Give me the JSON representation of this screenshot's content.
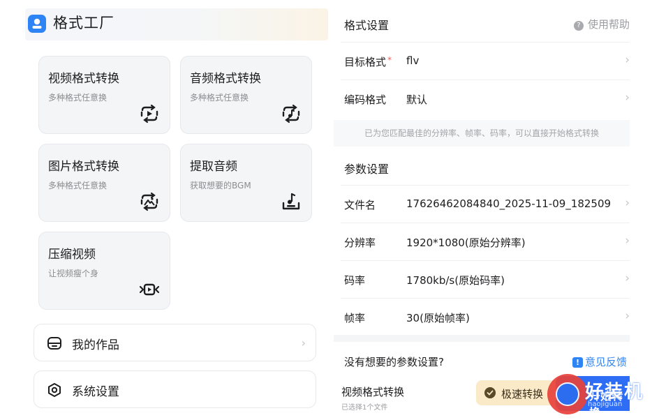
{
  "app": {
    "title": "格式工厂",
    "logo_icon": "user-icon",
    "accent": "#2e84f5"
  },
  "tools": [
    {
      "title": "视频格式转换",
      "subtitle": "多种格式任意换",
      "icon": "video-convert-icon"
    },
    {
      "title": "音频格式转换",
      "subtitle": "多种格式任意换",
      "icon": "audio-convert-icon"
    },
    {
      "title": "图片格式转换",
      "subtitle": "多种格式任意换",
      "icon": "image-convert-icon"
    },
    {
      "title": "提取音频",
      "subtitle": "获取想要的BGM",
      "icon": "extract-audio-icon"
    },
    {
      "title": "压缩视频",
      "subtitle": "让视频瘦个身",
      "icon": "compress-video-icon"
    }
  ],
  "menu": {
    "works": {
      "label": "我的作品",
      "icon": "album-icon",
      "chevron": "›"
    },
    "settings": {
      "label": "系统设置",
      "icon": "settings-icon"
    }
  },
  "format_settings": {
    "title": "格式设置",
    "help": "使用帮助",
    "help_icon": "?",
    "target_label": "目标格式",
    "required_mark": "*",
    "target_value": "flv",
    "codec_label": "编码格式",
    "codec_value": "默认",
    "hint": "已为您匹配最佳的分辨率、帧率、码率，可以直接开始格式转换"
  },
  "param_settings": {
    "title": "参数设置",
    "rows": [
      {
        "label": "文件名",
        "value": "17626462084840_2025-11-09_182509"
      },
      {
        "label": "分辨率",
        "value": "1920*1080(原始分辨率)"
      },
      {
        "label": "码率",
        "value": "1780kb/s(原始码率)"
      },
      {
        "label": "帧率",
        "value": "30(原始帧率)"
      }
    ],
    "chevron": "›"
  },
  "feedback": {
    "question": "没有想要的参数设置?",
    "link": "意见反馈",
    "icon": "!"
  },
  "bottom": {
    "title": "视频格式转换",
    "subtitle": "已选择1个文件",
    "fast_label": "极速转换",
    "start_label": "开始转换",
    "watermark_text": "好装机",
    "watermark_sub": "haojiguan"
  }
}
